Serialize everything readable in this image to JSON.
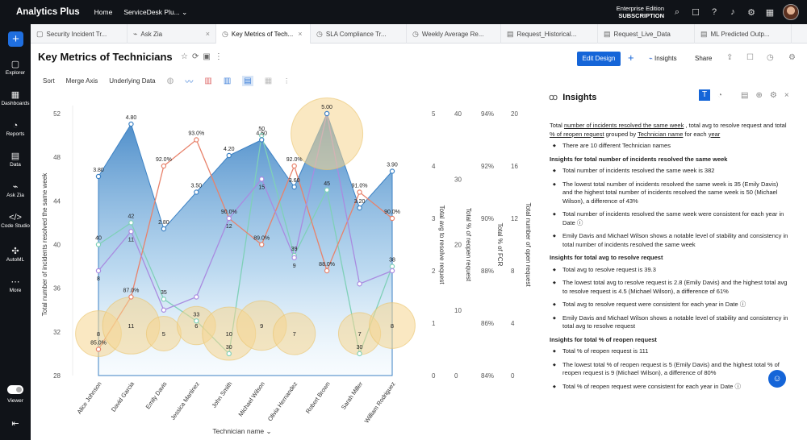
{
  "topbar": {
    "app": "Analytics Plus",
    "nav": [
      "Home",
      "ServiceDesk Plu... ⌄"
    ],
    "edition": "Enterprise Edition",
    "subscription": "SUBSCRIPTION"
  },
  "sidebar": {
    "items": [
      "Explorer",
      "Dashboards",
      "Reports",
      "Data",
      "Ask Zia",
      "Code Studio",
      "AutoML",
      "More"
    ],
    "viewer": "Viewer"
  },
  "tabs": [
    "Security Incident Tr...",
    "Ask Zia",
    "Key Metrics of Tech...",
    "SLA Compliance Tr...",
    "Weekly Average Re...",
    "Request_Historical...",
    "Request_Live_Data",
    "ML Predicted Outp..."
  ],
  "report": {
    "title": "Key Metrics of Technicians",
    "edit": "Edit Design",
    "insights": "Insights",
    "share": "Share"
  },
  "toolbar": {
    "sort": "Sort",
    "merge": "Merge Axis",
    "underlying": "Underlying Data"
  },
  "chart_data": {
    "type": "area",
    "xlabel": "Technician name",
    "categories": [
      "Alice Johnson",
      "David Garcia",
      "Emily Davis",
      "Jessica Martinez",
      "John Smith",
      "Michael Wilson",
      "Olivia Hernandez",
      "Robert Brown",
      "Sarah Miller",
      "William Rodriguez"
    ],
    "series": [
      {
        "name": "Total number of incidents resolved the same week",
        "values": [
          40,
          42,
          35,
          33,
          30,
          50,
          39,
          45,
          30,
          38
        ],
        "color": "#7fd0b8"
      },
      {
        "name": "Total avg to resolve request",
        "values": [
          3.8,
          4.8,
          2.8,
          3.5,
          4.2,
          4.5,
          3.6,
          5.0,
          3.2,
          3.9
        ],
        "color": "#5a9bd5"
      },
      {
        "name": "Total % of reopen request",
        "values": [
          8,
          11,
          5,
          6,
          10,
          9,
          7,
          15,
          7,
          8
        ],
        "color": "#f5c96b"
      },
      {
        "name": "Total % of FCR",
        "values": [
          85.0,
          87.0,
          92.0,
          93.0,
          90.0,
          89.0,
          92.0,
          88.0,
          91.0,
          90.0
        ],
        "color": "#e8826b"
      },
      {
        "name": "Total number of open request",
        "values": [
          8,
          11,
          5,
          6,
          12,
          15,
          9,
          20,
          7,
          8
        ],
        "color": "#a98be0"
      }
    ],
    "yaxes": [
      {
        "label": "Total number of incidents resolved the same week",
        "ticks": [
          "28",
          "32",
          "36",
          "40",
          "44",
          "48",
          "52"
        ],
        "range": [
          28,
          52
        ]
      },
      {
        "label": "Total avg to resolve request",
        "ticks": [
          "0",
          "1",
          "2",
          "3",
          "4",
          "5"
        ],
        "range": [
          0,
          5
        ]
      },
      {
        "label": "Total % of reopen request",
        "ticks": [
          "0",
          "10",
          "20",
          "30",
          "40"
        ],
        "range": [
          0,
          40
        ]
      },
      {
        "label": "Total % of FCR",
        "ticks": [
          "84%",
          "86%",
          "88%",
          "90%",
          "92%",
          "94%"
        ],
        "range": [
          84,
          94
        ]
      },
      {
        "label": "Total number of open request",
        "ticks": [
          "0",
          "4",
          "8",
          "12",
          "16",
          "20"
        ],
        "range": [
          0,
          20
        ]
      }
    ],
    "labels": {
      "incidents": [
        "40",
        "42",
        "35",
        "33",
        "30",
        "50",
        "39",
        "45",
        "30",
        "38"
      ],
      "avg": [
        "3.80",
        "4.80",
        "2.80",
        "3.50",
        "4.20",
        "4.50",
        "3.60",
        "5.00",
        "3.20",
        "3.90"
      ],
      "reopen": [
        "8",
        "11",
        "5",
        "6",
        "10",
        "9",
        "7",
        "",
        "7",
        "8"
      ],
      "fcr": [
        "85.0%",
        "87.0%",
        "92.0%",
        "93.0%",
        "90.0%",
        "89.0%",
        "92.0%",
        "88.0%",
        "91.0%",
        "90.0%"
      ],
      "open": [
        "8",
        "11",
        "",
        "",
        "12",
        "15",
        "9",
        "",
        "",
        ""
      ]
    }
  },
  "insights": {
    "title": "Insights",
    "intro_a": "Total ",
    "intro_u1": "number of incidents resolved the same week",
    "intro_b": " , total avg to resolve request and total ",
    "intro_u2": "% of reopen request",
    "intro_c": " grouped by ",
    "intro_u3": "Technician name",
    "intro_d": " for each ",
    "intro_u4": "year",
    "count_line": "There are 10 different Technician names",
    "sections": [
      {
        "h": "Insights for total number of incidents resolved the same week",
        "b1": "Total number of incidents resolved the same week is 382",
        "b2": "The lowest total number of incidents resolved the same week is 35 (Emily Davis) and the highest total number of incidents resolved the same week is 50 (Michael Wilson), a difference of 43%",
        "b3": "Total number of incidents resolved the same week were consistent for each year in Date ⓘ",
        "b4": "Emily Davis and Michael Wilson shows a notable level of stability and consistency in total number of incidents resolved the same week"
      },
      {
        "h": "Insights for total avg to resolve request",
        "b1": "Total avg to resolve request is 39.3",
        "b2": "The lowest total avg to resolve request is 2.8 (Emily Davis) and the highest total avg to resolve request is 4.5 (Michael Wilson), a difference of 61%",
        "b3": "Total avg to resolve request were consistent for each year in Date ⓘ",
        "b4": "Emily Davis and Michael Wilson shows a notable level of stability and consistency in total avg to resolve request"
      },
      {
        "h": "Insights for total % of reopen request",
        "b1": "Total % of reopen request is 111",
        "b2": "The lowest total % of reopen request is 5 (Emily Davis) and the highest total % of reopen request is 9 (Michael Wilson), a difference of 80%",
        "b3": "Total % of reopen request were consistent for each year in Date ⓘ"
      }
    ]
  }
}
